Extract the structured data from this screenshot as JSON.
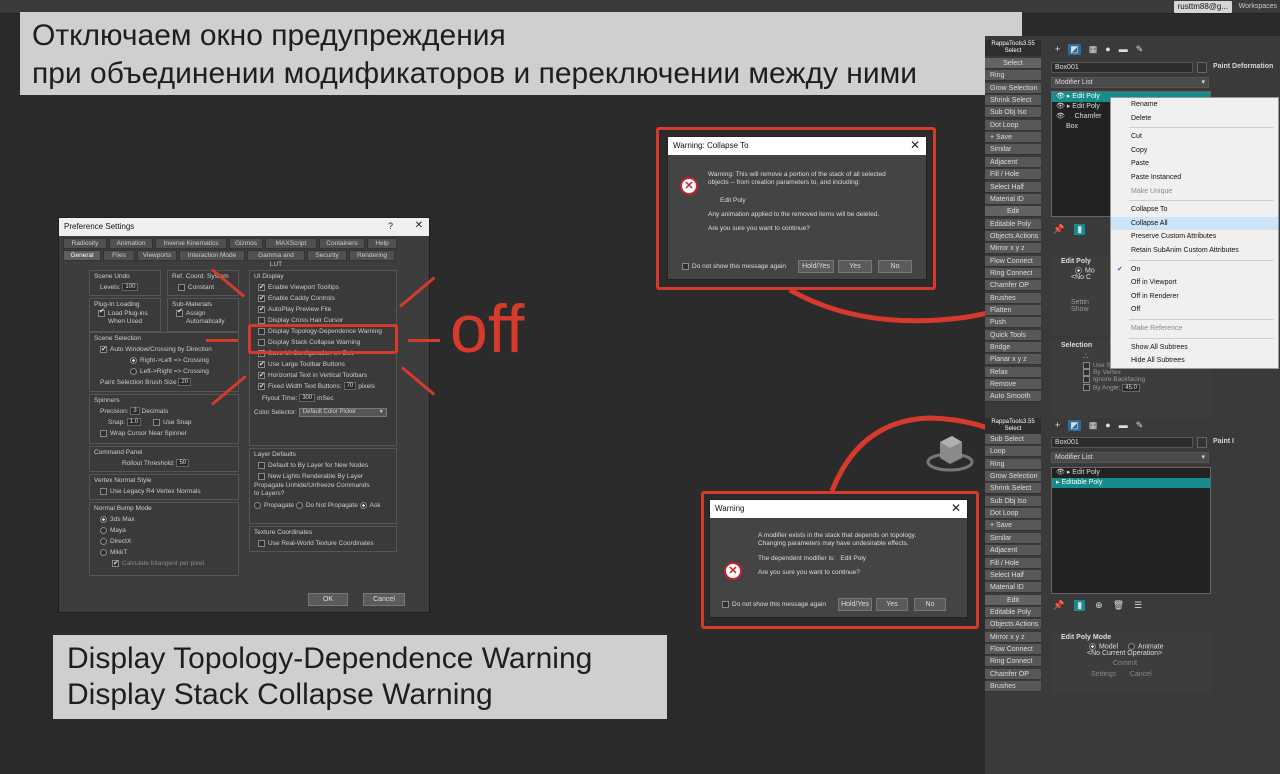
{
  "topbar": {
    "user": "rusttm88@g...",
    "workspace": "Workspaces"
  },
  "captions": {
    "top_line1": "Отключаем окно предупреждения",
    "top_line2": "при объединении модификаторов и переключении между ними",
    "bottom_line1": "Display Topology-Dependence Warning",
    "bottom_line2": "Display Stack Collapse Warning"
  },
  "off_label": "off",
  "pref": {
    "title": "Preference Settings",
    "help_glyph": "?",
    "close_glyph": "✕",
    "tabs_row1": [
      "Radiosity",
      "Animation",
      "Inverse Kinematics",
      "Gizmos",
      "MAXScript",
      "Containers",
      "Help"
    ],
    "tabs_row2": [
      "General",
      "Files",
      "Viewports",
      "Interaction Mode",
      "Gamma and LUT",
      "Security",
      "Rendering"
    ],
    "scene_undo": {
      "title": "Scene Undo",
      "levels_label": "Levels:",
      "levels_value": "100"
    },
    "ref_coord": {
      "title": "Ref. Coord. System",
      "constant": "Constant"
    },
    "plugin_loading": {
      "title": "Plug-In Loading",
      "load_line1": "Load Plug-ins",
      "load_line2": "When Used"
    },
    "sub_materials": {
      "title": "Sub-Materials",
      "assign_line1": "Assign",
      "assign_line2": "Automatically"
    },
    "scene_selection": {
      "title": "Scene Selection",
      "auto_window": "Auto Window/Crossing by Direction",
      "right_left": "Right->Left => Crossing",
      "left_right": "Left->Right => Crossing",
      "brush_label": "Paint Selection Brush Size",
      "brush_value": "20"
    },
    "spinners": {
      "title": "Spinners",
      "precision_label": "Precision:",
      "precision_value": "3",
      "decimals": "Decimals",
      "snap_label": "Snap:",
      "snap_value": "1.0",
      "use_snap": "Use Snap",
      "wrap": "Wrap Cursor Near Spinner"
    },
    "command_panel": {
      "title": "Command Panel",
      "rollout_label": "Rollout Threshold:",
      "rollout_value": "50"
    },
    "vertex_normal": {
      "title": "Vertex Normal Style",
      "legacy": "Use Legacy R4 Vertex Normals"
    },
    "normal_bump": {
      "title": "Normal Bump Mode",
      "opt1": "3ds Max",
      "opt2": "Maya",
      "opt3": "DirectX",
      "opt4": "MikkT",
      "calc": "Calculate bitangent per pixel"
    },
    "ui_display": {
      "title": "UI Display",
      "items": [
        "Enable Viewport Tooltips",
        "Enable Caddy Controls",
        "AutoPlay Preview File",
        "Display Cross Hair Cursor",
        "Display Topology-Dependence Warning",
        "Display Stack Collapse Warning",
        "Save UI Configuration on Exit",
        "Use Large Toolbar Buttons",
        "Horizontal Text in Vertical Toolbars",
        "Fixed Width Text Buttons:"
      ],
      "fixed_width_value": "70",
      "pixels": "pixels",
      "flyout_label": "Flyout Time:",
      "flyout_value": "300",
      "msec": "mSec",
      "color_selector_label": "Color Selector:",
      "color_selector_value": "Default Color Picker"
    },
    "layer_defaults": {
      "title": "Layer Defaults",
      "by_layer": "Default to By Layer for New Nodes",
      "new_lights": "New Lights Renderable By Layer",
      "propagate_q1": "Propagate Unhide/Unfreeze Commands",
      "propagate_q2": "to Layers?",
      "opt_propagate": "Propagate",
      "opt_no": "Do Not Propagate",
      "opt_ask": "Ask"
    },
    "texture_coords": {
      "title": "Texture Coordinates",
      "real_world": "Use Real-World Texture Coordinates"
    },
    "ok": "OK",
    "cancel": "Cancel"
  },
  "collapse_dialog": {
    "title": "Warning: Collapse To",
    "close_glyph": "✕",
    "line1": "Warning: This will remove a portion of the stack of all selected",
    "line2": "objects -- from creation parameters to, and including:",
    "modifier": "Edit Poly",
    "line3": "Any animation applied to the removed items will be deleted.",
    "line4": "Are you sure you want to continue?",
    "dont_show": "Do not show this message again",
    "hold_yes": "Hold/Yes",
    "yes": "Yes",
    "no": "No"
  },
  "topo_dialog": {
    "title": "Warning",
    "close_glyph": "✕",
    "line1": "A modifier exists in the stack that depends on topology.",
    "line2": "Changing parameters may have undesirable effects.",
    "dep_label": "The dependent modifier is:",
    "dep_value": "Edit Poly",
    "line3": "Are you sure you want to continue?",
    "dont_show": "Do not show this message again",
    "hold_yes": "Hold/Yes",
    "yes": "Yes",
    "no": "No"
  },
  "rappa_top": {
    "title1": "RappaTools3.55",
    "title2": "Select",
    "buttons": [
      "Select",
      "Ring",
      "Grow Selection",
      "Shrink Select",
      "Sub Obj Iso",
      "Dot Loop",
      "+ Save",
      "Similar",
      "Adjacent",
      "Fill / Hole",
      "Select Half",
      "Material ID",
      "Edit",
      "Editable Poly",
      "Objects Actions",
      "Mirror x y z",
      "Flow Connect",
      "Ring Connect",
      "Chamfer OP",
      "Brushes",
      "Flatten",
      "Push",
      "Quick Tools",
      "Bridge",
      "Planar x y z",
      "Relax",
      "Remove",
      "Auto Smooth"
    ]
  },
  "rappa_bottom": {
    "title1": "RappaTools3.55",
    "title2": "Select",
    "buttons": [
      "Sub Select",
      "Loop",
      "Ring",
      "Grow Selection",
      "Shrink Select",
      "Sub Obj Iso",
      "Dot Loop",
      "+ Save",
      "Similar",
      "Adjacent",
      "Fill / Hole",
      "Select Half",
      "Material ID",
      "Edit",
      "Editable Poly",
      "Objects Actions",
      "Mirror x y z",
      "Flow Connect",
      "Ring Connect",
      "Chamfer OP",
      "Brushes"
    ]
  },
  "modify_top": {
    "object_name": "Box001",
    "modifier_list": "Modifier List",
    "paint_deform": "Paint Deformation",
    "stack": [
      "Edit Poly",
      "Edit Poly",
      "Chamfer",
      "Box"
    ],
    "rollout_edit_poly": "Edit Poly",
    "model_label": "Mo",
    "no_op": "<No C",
    "settings": "Settin",
    "show": "Show",
    "selection": "Selection",
    "use_stack": "Use Stack Selection",
    "by_vertex": "By Vertex",
    "ignore_backfacing": "Ignore Backfacing",
    "by_angle": "By Angle:",
    "by_angle_value": "45.0"
  },
  "context_menu": {
    "items": [
      {
        "label": "Rename",
        "state": "normal"
      },
      {
        "label": "Delete",
        "state": "normal"
      },
      {
        "sep": true
      },
      {
        "label": "Cut",
        "state": "normal"
      },
      {
        "label": "Copy",
        "state": "normal"
      },
      {
        "label": "Paste",
        "state": "normal"
      },
      {
        "label": "Paste Instanced",
        "state": "normal"
      },
      {
        "label": "Make Unique",
        "state": "disabled"
      },
      {
        "sep": true
      },
      {
        "label": "Collapse To",
        "state": "normal"
      },
      {
        "label": "Collapse All",
        "state": "highlight"
      },
      {
        "label": "Preserve Custom Attributes",
        "state": "normal"
      },
      {
        "label": "Retain SubAnim Custom Attributes",
        "state": "normal"
      },
      {
        "sep": true
      },
      {
        "label": "On",
        "state": "checked"
      },
      {
        "label": "Off in Viewport",
        "state": "normal"
      },
      {
        "label": "Off in Renderer",
        "state": "normal"
      },
      {
        "label": "Off",
        "state": "normal"
      },
      {
        "sep": true
      },
      {
        "label": "Make Reference",
        "state": "disabled"
      },
      {
        "sep": true
      },
      {
        "label": "Show All Subtrees",
        "state": "normal"
      },
      {
        "label": "Hide All Subtrees",
        "state": "normal"
      }
    ]
  },
  "modify_bottom": {
    "object_name": "Box001",
    "modifier_list": "Modifier List",
    "paint": "Paint I",
    "stack": [
      "Edit Poly",
      "Editable Poly"
    ],
    "rollout": "Edit Poly Mode",
    "model": "Model",
    "animate": "Animate",
    "no_op": "<No Current Operation>",
    "commit": "Commit",
    "settings": "Settings",
    "cancel": "Cancel"
  },
  "colors": {
    "accent": "#d63a2c",
    "highlight": "#168c8c"
  }
}
